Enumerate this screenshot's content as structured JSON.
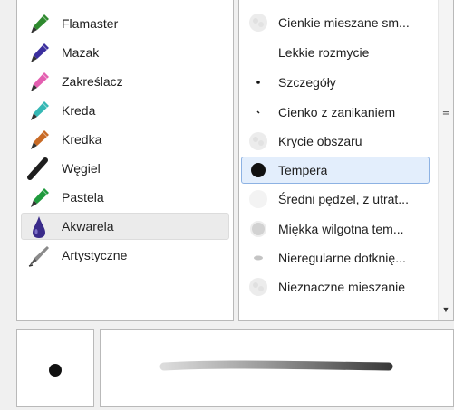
{
  "tools": [
    {
      "label": "Flamaster",
      "icon": "flamaster-icon",
      "color": "#2f8a2f"
    },
    {
      "label": "Mazak",
      "icon": "mazak-icon",
      "color": "#3b2f9e"
    },
    {
      "label": "Zakreślacz",
      "icon": "zakreslacz-icon",
      "color": "#e35fb0"
    },
    {
      "label": "Kreda",
      "icon": "kreda-icon",
      "color": "#35b8b5"
    },
    {
      "label": "Kredka",
      "icon": "kredka-icon",
      "color": "#c86a25"
    },
    {
      "label": "Węgiel",
      "icon": "wegiel-icon",
      "color": "#1e1e1e"
    },
    {
      "label": "Pastela",
      "icon": "pastela-icon",
      "color": "#1f9a3d"
    },
    {
      "label": "Akwarela",
      "icon": "akwarela-icon",
      "color": "#3a2b8a",
      "selected": true
    },
    {
      "label": "Artystyczne",
      "icon": "artystyczne-icon",
      "color": "#8a8a8a"
    }
  ],
  "brushes": [
    {
      "label": "Cienkie mieszane sm...",
      "preview": "soft-texture"
    },
    {
      "label": "Lekkie rozmycie",
      "preview": "none"
    },
    {
      "label": "Szczegóły",
      "preview": "tiny-dot"
    },
    {
      "label": "Cienko z zanikaniem",
      "preview": "tick"
    },
    {
      "label": "Krycie obszaru",
      "preview": "soft-texture"
    },
    {
      "label": "Tempera",
      "preview": "solid-dot",
      "selected": true
    },
    {
      "label": "Średni pędzel, z utrat...",
      "preview": "faint-blob"
    },
    {
      "label": "Miękka wilgotna tem...",
      "preview": "soft-gray-dot"
    },
    {
      "label": "Nieregularne dotknię...",
      "preview": "small-smudge"
    },
    {
      "label": "Nieznaczne mieszanie",
      "preview": "soft-texture"
    }
  ],
  "scrollbar": {
    "grip_icon": "grip-lines-icon",
    "grip_glyph": "≡",
    "down_glyph": "▼"
  },
  "preview": {
    "dot_color": "#111111",
    "stroke_color": "#3a3a3a"
  }
}
